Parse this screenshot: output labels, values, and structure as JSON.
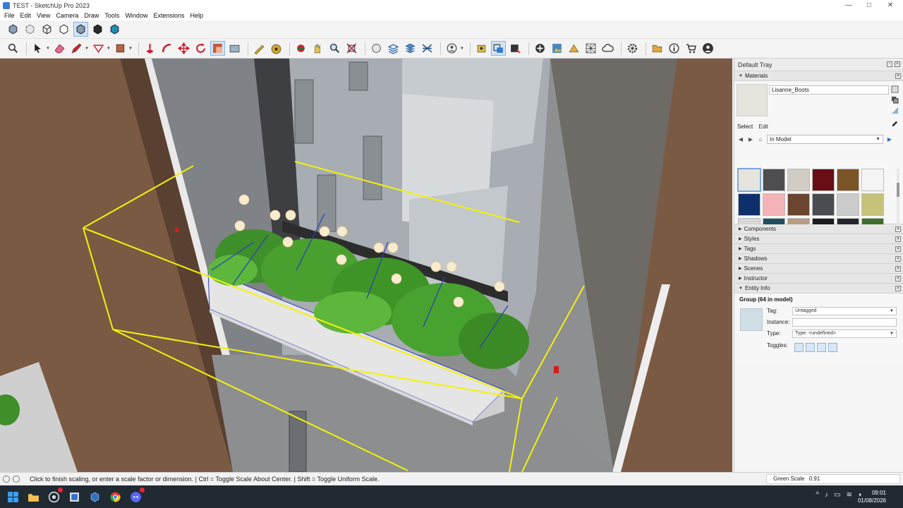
{
  "window": {
    "title": "TEST - SketchUp Pro 2023",
    "controls": [
      "—",
      "□",
      "✕"
    ]
  },
  "menu": [
    "File",
    "Edit",
    "View",
    "Camera",
    "Draw",
    "Tools",
    "Window",
    "Extensions",
    "Help"
  ],
  "toolbar_row1": [
    "xray-face-style-icon",
    "back-edges-icon",
    "wireframe-icon",
    "hidden-line-icon",
    "shaded-icon",
    "shaded-textures-icon",
    "monochrome-icon"
  ],
  "toolbar_row2": [
    "search-icon",
    "select-icon",
    "eraser-icon",
    "pencil-line-icon",
    "lasso-icon",
    "paint-bucket-icon",
    "push-pull-icon",
    "follow-me-icon",
    "move-icon",
    "rotate-icon",
    "scale-icon",
    "offset-icon",
    "tape-measure-icon",
    "protractor-icon",
    "orbit-icon",
    "pan-icon",
    "zoom-icon",
    "zoom-extents-icon",
    "section-icon",
    "sandbox-icon",
    "layers-icon",
    "solid-tools-icon",
    "user-icon",
    "warehouse-icon",
    "extension-manager-icon",
    "dynamic-component-icon",
    "add-location-icon",
    "photo-texture-icon",
    "advanced-camera-icon",
    "match-photo-icon",
    "3d-text-icon",
    "cloud-icon",
    "settings-icon",
    "folder-icon",
    "info-icon",
    "cart-icon",
    "account-icon"
  ],
  "tray": {
    "title": "Default Tray",
    "materials": {
      "panel_title": "Materials",
      "material_name": "Lisanne_Boots",
      "tab_select": "Select",
      "tab_edit": "Edit",
      "collection": "In Model",
      "swatch_colors": [
        "#e6e4dd",
        "#4e4e51",
        "#d2cdc4",
        "#6b0d15",
        "#7b5525",
        "#f5f5f5",
        "#0e2f6b",
        "#f4b3b6",
        "#6b4530",
        "#494d51",
        "#cbcbcb",
        "#c6c27a",
        "#d8d8d8",
        "#1f4f61",
        "#b99b82",
        "#1a1b1d",
        "#25262e",
        "#3f6e2c"
      ]
    },
    "collapsed_panels": [
      "Components",
      "Styles",
      "Tags",
      "Shadows",
      "Scenes",
      "Instructor"
    ],
    "entity_info": {
      "panel_title": "Entity Info",
      "entity_title": "Group (64 in model)",
      "tag_label": "Tag:",
      "tag_value": "Untagged",
      "instance_label": "Instance:",
      "instance_value": "",
      "type_label": "Type:",
      "type_value": "Type: <undefined>",
      "toggles_label": "Toggles:"
    }
  },
  "status": {
    "message": "Click to finish scaling, or enter a scale factor or dimension. | Ctrl = Toggle Scale About Center. | Shift = Toggle Uniform Scale.",
    "measure_label": "Green Scale",
    "measure_value": "0.91"
  },
  "taskbar": {
    "time": "09:01",
    "date": "01/08/2026",
    "apps": [
      "windows-start-icon",
      "file-explorer-icon",
      "chrome-canary-icon",
      "sketchup-layout-icon",
      "sketchup-icon",
      "chrome-icon",
      "discord-icon"
    ]
  }
}
